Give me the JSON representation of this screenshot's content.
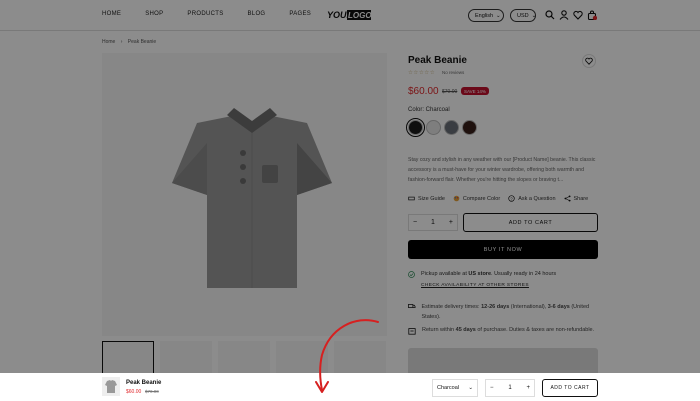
{
  "header": {
    "nav": [
      "HOME",
      "SHOP",
      "PRODUCTS",
      "BLOG",
      "PAGES"
    ],
    "logo_text_1": "YOUR",
    "logo_text_2": "LOGO",
    "language": "English",
    "currency": "USD",
    "cart_count": "0"
  },
  "breadcrumb": {
    "home": "Home",
    "sep": "›",
    "current": "Peak Beanie"
  },
  "product": {
    "title": "Peak Beanie",
    "stars": "☆☆☆☆☆",
    "reviews": "No reviews",
    "price": "$60.00",
    "compare_price": "$70.00",
    "save_badge": "SAVE 14%",
    "color_label": "Color: Charcoal",
    "swatches": [
      "#1b1b1b",
      "#e6e6e6",
      "#6b7079",
      "#3a1f1a"
    ],
    "description": "Stay cozy and stylish in any weather with our [Product Name] beanie. This classic accessory is a must-have for your winter wardrobe, offering both warmth and fashion-forward flair. Whether you're hitting the slopes or braving t...",
    "links": [
      "Size Guide",
      "Compare Color",
      "Ask a Question",
      "Share"
    ],
    "quantity": "1",
    "add_to_cart": "ADD TO CART",
    "buy_now": "BUY IT NOW",
    "pickup_prefix": "Pickup available at ",
    "pickup_store": "US store",
    "pickup_suffix": ". Usually ready in 24 hours",
    "check_availability": "CHECK AVAILABILITY AT OTHER STORES",
    "delivery_prefix": "Estimate delivery times: ",
    "delivery_intl": "12-26 days",
    "delivery_mid": " (International), ",
    "delivery_us": "3-6 days",
    "delivery_suffix": " (United States).",
    "returns_prefix": "Return within ",
    "returns_days": "45 days",
    "returns_suffix": " of purchase. Duties & taxes are non-refundable."
  },
  "sticky_bar": {
    "title": "Peak Beanie",
    "price": "$60.00",
    "compare_price": "$70.00",
    "variant": "Charcoal",
    "quantity": "1",
    "add_to_cart": "ADD TO CART"
  },
  "colors": {
    "accent_red": "#e0282c",
    "save_badge": "#c4112f",
    "arrow": "#d62020"
  }
}
